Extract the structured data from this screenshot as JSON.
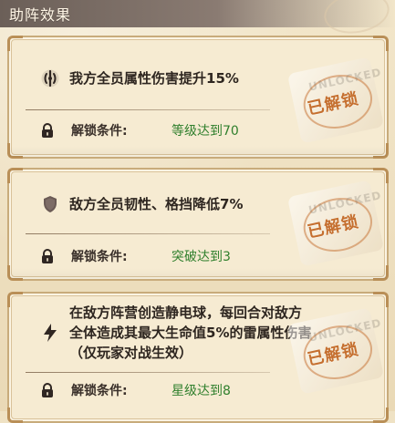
{
  "header": {
    "title": "助阵效果"
  },
  "cards": [
    {
      "effect_icon": "rune-icon",
      "effect_text": "我方全员属性伤害提升15%",
      "unlock_label": "解锁条件:",
      "unlock_value": "等级达到70",
      "stamp_label": "已解锁",
      "stamp_bg_word": "UNLOCKED"
    },
    {
      "effect_icon": "shield-icon",
      "effect_text": "敌方全员韧性、格挡降低7%",
      "unlock_label": "解锁条件:",
      "unlock_value": "突破达到3",
      "stamp_label": "已解锁",
      "stamp_bg_word": "UNLOCKED"
    },
    {
      "effect_icon": "lightning-icon",
      "effect_text": "在敌方阵营创造静电球，每回合对敌方全体造成其最大生命值5%的雷属性伤害（仅玩家对战生效）",
      "unlock_label": "解锁条件:",
      "unlock_value": "星级达到8",
      "stamp_label": "已解锁",
      "stamp_bg_word": "UNLOCKED"
    }
  ],
  "colors": {
    "unlock_value_green": "#2f7f2c",
    "stamp_orange": "#c56f2f",
    "header_bg": "#6b5f58",
    "card_bg": "#f6ebd2",
    "card_border": "#c8ab7b"
  }
}
